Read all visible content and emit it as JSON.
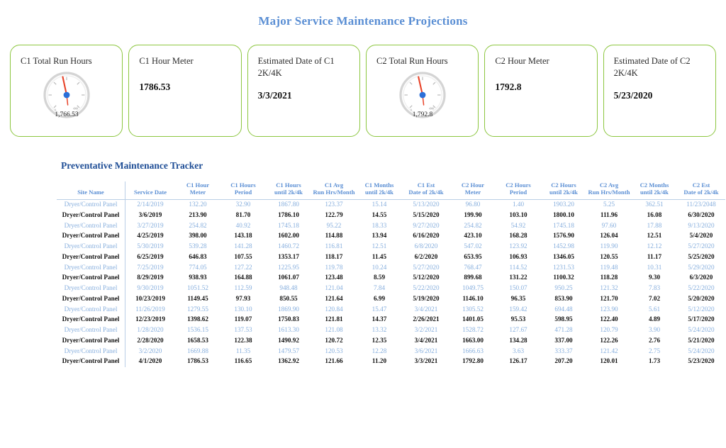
{
  "report": {
    "title": "Major Service Maintenance Projections",
    "section_heading": "Preventative Maintenance Tracker",
    "accent_green": "#8cc63f",
    "accent_blue": "#5b8fd4",
    "heading_blue": "#1f4e96"
  },
  "kpi_cards": [
    {
      "title": "C1 Total Run Hours",
      "type": "gauge",
      "gauge_value_label": "1,766.53",
      "gauge_min_label": "0",
      "gauge_max_label": "4000",
      "needle_pct": 0.47
    },
    {
      "title": "C1 Hour Meter",
      "type": "value",
      "value": "1786.53"
    },
    {
      "title": "Estimated Date of C1 2K/4K",
      "type": "value",
      "value": "3/3/2021"
    },
    {
      "title": "C2 Total Run Hours",
      "type": "gauge",
      "gauge_value_label": "1,792.8",
      "gauge_min_label": "0",
      "gauge_max_label": "4000",
      "needle_pct": 0.46
    },
    {
      "title": "C2 Hour Meter",
      "type": "value",
      "value": "1792.8"
    },
    {
      "title": "Estimated Date of C2 2K/4K",
      "type": "value",
      "value": "5/23/2020"
    }
  ],
  "table": {
    "columns": [
      "Site Name",
      "Service Date",
      "C1 Hour Meter",
      "C1 Hours Period",
      "C1 Hours until 2k/4k",
      "C1 Avg Run Hrs/Month",
      "C1 Months until 2k/4k",
      "C1 Est Date of 2k/4k",
      "C2 Hour Meter",
      "C2 Hours Period",
      "C2 Hours until 2k/4k",
      "C2 Avg Run Hrs/Month",
      "C2 Months until 2k/4k",
      "C2 Est Date of 2k/4k"
    ],
    "rows": [
      [
        "Dryer/Control Panel",
        "2/14/2019",
        "132.20",
        "32.90",
        "1867.80",
        "123.37",
        "15.14",
        "5/13/2020",
        "96.80",
        "1.40",
        "1903.20",
        "5.25",
        "362.51",
        "11/23/2048"
      ],
      [
        "Dryer/Control Panel",
        "3/6/2019",
        "213.90",
        "81.70",
        "1786.10",
        "122.79",
        "14.55",
        "5/15/2020",
        "199.90",
        "103.10",
        "1800.10",
        "111.96",
        "16.08",
        "6/30/2020"
      ],
      [
        "Dryer/Control Panel",
        "3/27/2019",
        "254.82",
        "40.92",
        "1745.18",
        "95.22",
        "18.33",
        "9/27/2020",
        "254.82",
        "54.92",
        "1745.18",
        "97.60",
        "17.88",
        "9/13/2020"
      ],
      [
        "Dryer/Control Panel",
        "4/25/2019",
        "398.00",
        "143.18",
        "1602.00",
        "114.88",
        "13.94",
        "6/16/2020",
        "423.10",
        "168.28",
        "1576.90",
        "126.04",
        "12.51",
        "5/4/2020"
      ],
      [
        "Dryer/Control Panel",
        "5/30/2019",
        "539.28",
        "141.28",
        "1460.72",
        "116.81",
        "12.51",
        "6/8/2020",
        "547.02",
        "123.92",
        "1452.98",
        "119.90",
        "12.12",
        "5/27/2020"
      ],
      [
        "Dryer/Control Panel",
        "6/25/2019",
        "646.83",
        "107.55",
        "1353.17",
        "118.17",
        "11.45",
        "6/2/2020",
        "653.95",
        "106.93",
        "1346.05",
        "120.55",
        "11.17",
        "5/25/2020"
      ],
      [
        "Dryer/Control Panel",
        "7/25/2019",
        "774.05",
        "127.22",
        "1225.95",
        "119.78",
        "10.24",
        "5/27/2020",
        "768.47",
        "114.52",
        "1231.53",
        "119.48",
        "10.31",
        "5/29/2020"
      ],
      [
        "Dryer/Control Panel",
        "8/29/2019",
        "938.93",
        "164.88",
        "1061.07",
        "123.48",
        "8.59",
        "5/12/2020",
        "899.68",
        "131.22",
        "1100.32",
        "118.28",
        "9.30",
        "6/3/2020"
      ],
      [
        "Dryer/Control Panel",
        "9/30/2019",
        "1051.52",
        "112.59",
        "948.48",
        "121.04",
        "7.84",
        "5/22/2020",
        "1049.75",
        "150.07",
        "950.25",
        "121.32",
        "7.83",
        "5/22/2020"
      ],
      [
        "Dryer/Control Panel",
        "10/23/2019",
        "1149.45",
        "97.93",
        "850.55",
        "121.64",
        "6.99",
        "5/19/2020",
        "1146.10",
        "96.35",
        "853.90",
        "121.70",
        "7.02",
        "5/20/2020"
      ],
      [
        "Dryer/Control Panel",
        "11/26/2019",
        "1279.55",
        "130.10",
        "1869.90",
        "120.84",
        "15.47",
        "3/4/2021",
        "1305.52",
        "159.42",
        "694.48",
        "123.90",
        "5.61",
        "5/12/2020"
      ],
      [
        "Dryer/Control Panel",
        "12/23/2019",
        "1398.62",
        "119.07",
        "1750.83",
        "121.81",
        "14.37",
        "2/26/2021",
        "1401.05",
        "95.53",
        "598.95",
        "122.40",
        "4.89",
        "5/17/2020"
      ],
      [
        "Dryer/Control Panel",
        "1/28/2020",
        "1536.15",
        "137.53",
        "1613.30",
        "121.08",
        "13.32",
        "3/2/2021",
        "1528.72",
        "127.67",
        "471.28",
        "120.79",
        "3.90",
        "5/24/2020"
      ],
      [
        "Dryer/Control Panel",
        "2/28/2020",
        "1658.53",
        "122.38",
        "1490.92",
        "120.72",
        "12.35",
        "3/4/2021",
        "1663.00",
        "134.28",
        "337.00",
        "122.26",
        "2.76",
        "5/21/2020"
      ],
      [
        "Dryer/Control Panel",
        "3/2/2020",
        "1669.88",
        "11.35",
        "1479.57",
        "120.53",
        "12.28",
        "3/6/2021",
        "1666.63",
        "3.63",
        "333.37",
        "121.42",
        "2.75",
        "5/24/2020"
      ],
      [
        "Dryer/Control Panel",
        "4/1/2020",
        "1786.53",
        "116.65",
        "1362.92",
        "121.66",
        "11.20",
        "3/3/2021",
        "1792.80",
        "126.17",
        "207.20",
        "120.01",
        "1.73",
        "5/23/2020"
      ]
    ]
  }
}
